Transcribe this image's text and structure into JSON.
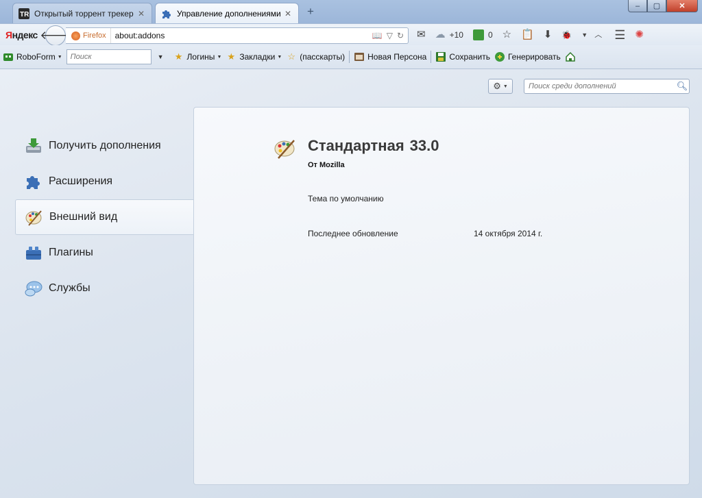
{
  "tabs": [
    {
      "label": "Открытый торрент трекер",
      "icon": "tr-favicon-icon"
    },
    {
      "label": "Управление дополнениями",
      "icon": "puzzle-icon"
    }
  ],
  "window": {
    "min": "–",
    "max": "▢",
    "close": "✕",
    "new_tab": "+"
  },
  "navbar": {
    "brand_first": "Я",
    "brand_rest": "ндекс",
    "identity": "Firefox",
    "url": "about:addons",
    "weather": "+10",
    "counter": "0"
  },
  "bookmarks": {
    "roboform": "RoboForm",
    "search_placeholder": "Поиск",
    "logins": "Логины",
    "bookmarks": "Закладки",
    "passcards": "(пасскарты)",
    "new_persona": "Новая Персона",
    "save": "Сохранить",
    "generate": "Генерировать"
  },
  "addons": {
    "search_placeholder": "Поиск среди дополнений",
    "categories": [
      {
        "label": "Получить дополнения",
        "icon": "get-addons-icon"
      },
      {
        "label": "Расширения",
        "icon": "extensions-icon"
      },
      {
        "label": "Внешний вид",
        "icon": "appearance-icon",
        "selected": true
      },
      {
        "label": "Плагины",
        "icon": "plugins-icon"
      },
      {
        "label": "Службы",
        "icon": "services-icon"
      }
    ],
    "detail": {
      "name": "Стандартная",
      "version": "33.0",
      "author": "От Mozilla",
      "description": "Тема по умолчанию",
      "updated_label": "Последнее обновление",
      "updated_value": "14 октября 2014 г."
    }
  },
  "colors": {
    "accent": "#2f5d9a",
    "close_button": "#c0402b"
  }
}
